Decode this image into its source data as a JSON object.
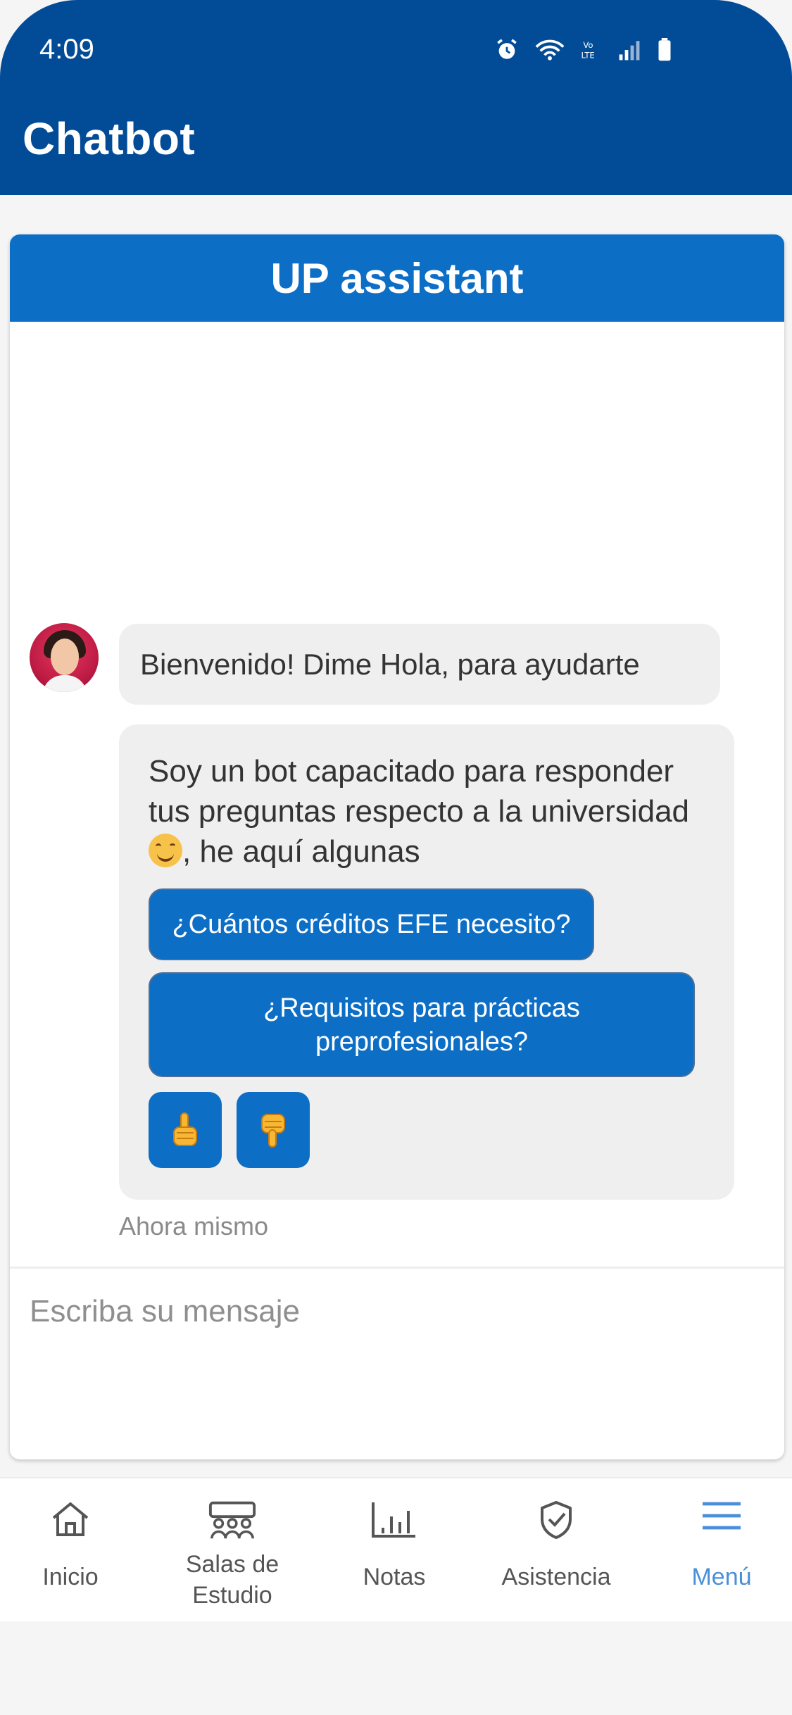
{
  "status_bar": {
    "time": "4:09"
  },
  "app": {
    "title": "Chatbot"
  },
  "chat": {
    "header": "UP assistant",
    "bot_avatar_icon": "bot-avatar-photo",
    "messages": {
      "greeting": "Bienvenido! Dime Hola, para ayudarte",
      "intro_before_emoji": "Soy un bot capacitado para responder tus preguntas respecto a la universidad ",
      "intro_after_emoji": ", he aquí algunas",
      "emoji": "smiling-face-emoji"
    },
    "quick_replies": [
      {
        "label": "¿Cuántos créditos EFE necesito?"
      },
      {
        "label": "¿Requisitos para prácticas preprofesionales?"
      }
    ],
    "feedback": {
      "like_icon": "thumbs-up-icon",
      "dislike_icon": "thumbs-down-icon"
    },
    "timestamp": "Ahora mismo",
    "input": {
      "placeholder": "Escriba su mensaje",
      "value": ""
    }
  },
  "bottom_nav": {
    "items": [
      {
        "label": "Inicio",
        "icon": "home-icon",
        "active": false
      },
      {
        "label": "Salas de Estudio",
        "icon": "study-rooms-icon",
        "active": false
      },
      {
        "label": "Notas",
        "icon": "grades-chart-icon",
        "active": false
      },
      {
        "label": "Asistencia",
        "icon": "shield-check-icon",
        "active": false
      },
      {
        "label": "Menú",
        "icon": "menu-icon",
        "active": true
      }
    ]
  },
  "colors": {
    "app_bar": "#024c97",
    "chat_header": "#0d6ec5",
    "bubble": "#efefef",
    "active_nav": "#4a8fd9"
  }
}
